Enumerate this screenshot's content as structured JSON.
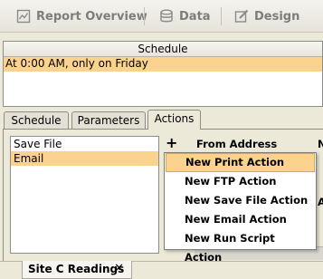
{
  "toolbar": {
    "report_overview": "Report Overview",
    "data": "Data",
    "design": "Design"
  },
  "schedule": {
    "header": "Schedule",
    "rows": [
      "At 0:00 AM, only on Friday"
    ]
  },
  "tabs": [
    {
      "label": "Schedule"
    },
    {
      "label": "Parameters"
    },
    {
      "label": "Actions",
      "active": true
    }
  ],
  "actions": {
    "items": [
      {
        "label": "Save File",
        "selected": false
      },
      {
        "label": "Email",
        "selected": true
      }
    ],
    "add_symbol": "+",
    "from_address_label": "From Address",
    "partial_label_n": "N",
    "partial_label_a": "A"
  },
  "context_menu": {
    "items": [
      {
        "label": "New Print Action",
        "hover": true
      },
      {
        "label": "New FTP Action"
      },
      {
        "label": "New Save File Action"
      },
      {
        "label": "New Email Action"
      },
      {
        "label": "New Run Script Action"
      }
    ]
  },
  "document_tab": {
    "label": "Site C Readings",
    "close_symbol": "✕"
  },
  "colors": {
    "selection": "#fbd38f",
    "window_bg": "#ece9d8"
  }
}
